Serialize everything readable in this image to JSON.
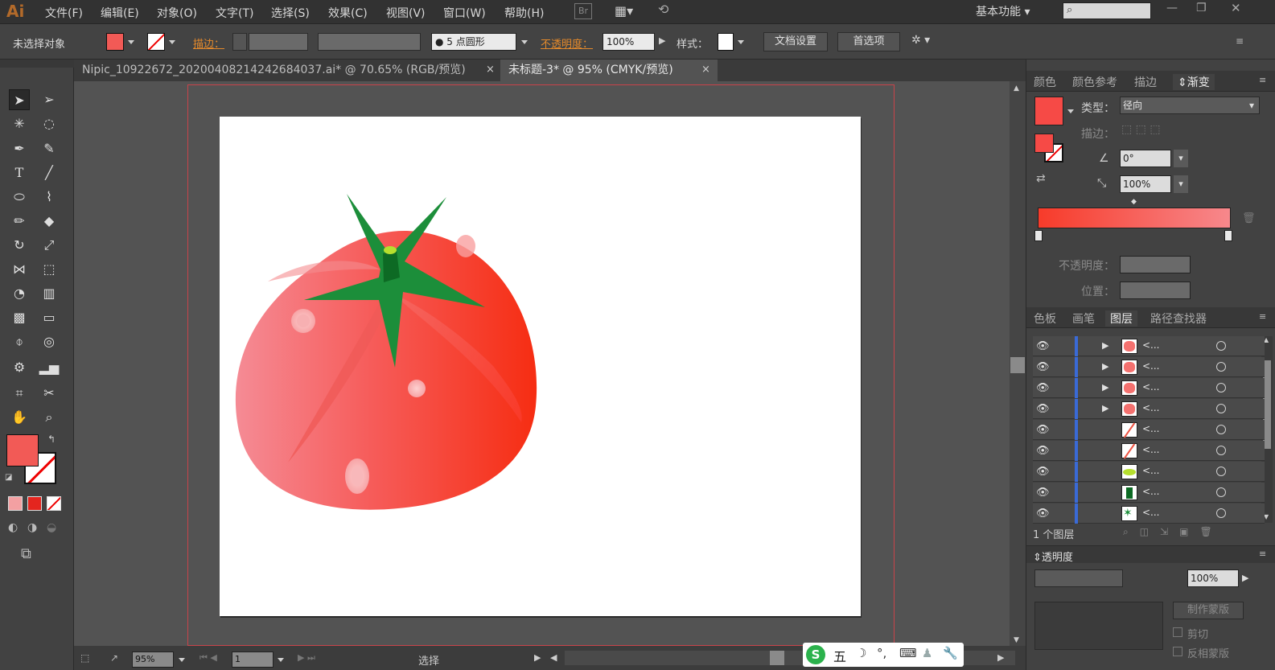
{
  "app": {
    "logo": "Ai",
    "workspace": "基本功能",
    "search_placeholder": "",
    "menu": [
      "文件(F)",
      "编辑(E)",
      "对象(O)",
      "文字(T)",
      "选择(S)",
      "效果(C)",
      "视图(V)",
      "窗口(W)",
      "帮助(H)"
    ]
  },
  "control": {
    "selection_label": "未选择对象",
    "stroke_label": "描边：",
    "brush_value": "5 点圆形",
    "opacity_label": "不透明度：",
    "opacity_value": "100%",
    "style_label": "样式：",
    "doc_settings": "文档设置",
    "preferences": "首选项"
  },
  "tabs": [
    {
      "label": "Nipic_10922672_20200408214242684037.ai* @ 70.65% (RGB/预览)",
      "close": "×"
    },
    {
      "label": "未标题-3* @ 95% (CMYK/预览)",
      "close": "×"
    }
  ],
  "gradient_panel": {
    "tabs": [
      "颜色",
      "颜色参考",
      "描边",
      "渐变"
    ],
    "type_label": "类型：",
    "type_value": "径向",
    "stroke_label": "描边：",
    "angle_value": "0°",
    "aspect_value": "100%",
    "opacity_label": "不透明度：",
    "position_label": "位置：",
    "gradient_start": "#f73b2a",
    "gradient_end": "#f7888c"
  },
  "layers_panel": {
    "tabs": [
      "色板",
      "画笔",
      "图层",
      "路径查找器"
    ],
    "rows": [
      {
        "name": "<...",
        "thumb": "tomato-piece",
        "expandable": true
      },
      {
        "name": "<...",
        "thumb": "tomato-piece",
        "expandable": true
      },
      {
        "name": "<...",
        "thumb": "tomato-piece",
        "expandable": true
      },
      {
        "name": "<...",
        "thumb": "tomato-piece",
        "expandable": true
      },
      {
        "name": "<...",
        "thumb": "red-line",
        "expandable": false
      },
      {
        "name": "<...",
        "thumb": "red-line",
        "expandable": false
      },
      {
        "name": "<...",
        "thumb": "green-ellipse",
        "expandable": false
      },
      {
        "name": "<...",
        "thumb": "dark-green-stem",
        "expandable": false
      },
      {
        "name": "<...",
        "thumb": "green-leaves",
        "expandable": false
      }
    ],
    "layer_count": "1 个图层"
  },
  "transparency_panel": {
    "title": "透明度",
    "opacity_value": "100%",
    "make_mask": "制作蒙版",
    "clip": "剪切",
    "invert_mask": "反相蒙版"
  },
  "status": {
    "zoom": "95%",
    "page": "1",
    "mode": "选择"
  },
  "ime": {
    "labels": [
      "五"
    ]
  }
}
